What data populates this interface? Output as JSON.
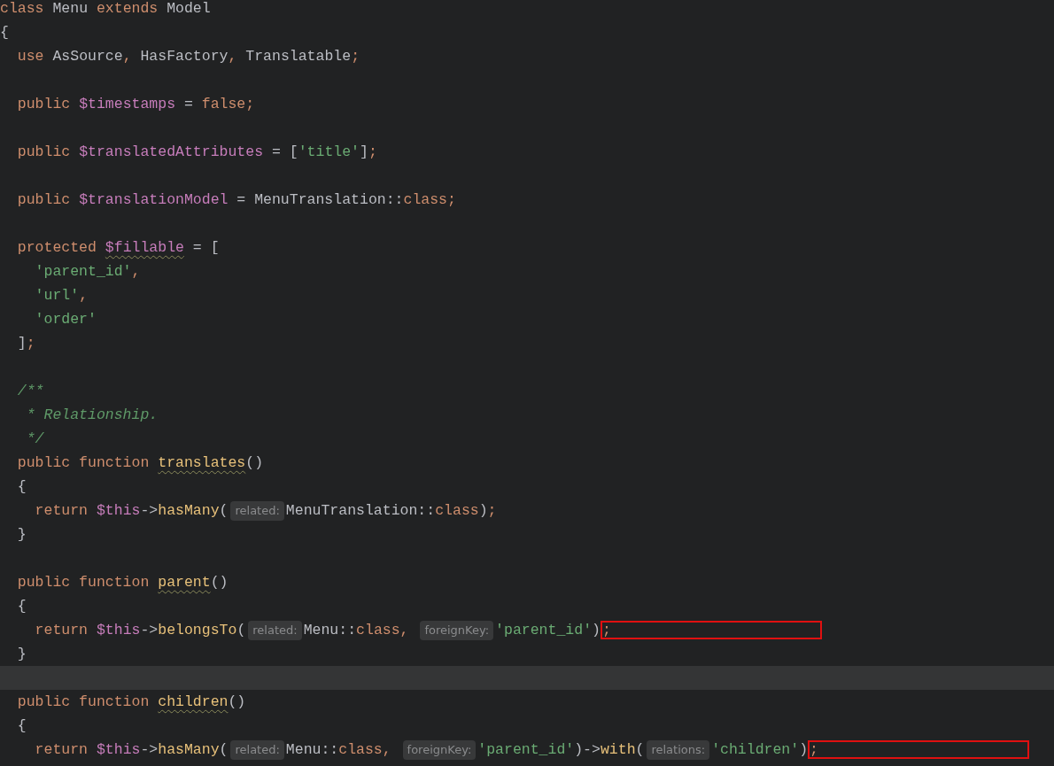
{
  "lines": [
    {
      "kind": "text",
      "segments": [
        {
          "kind": "code",
          "tokens": [
            {
              "text": "class ",
              "kind": "keyword"
            },
            {
              "text": "Menu ",
              "kind": "plain"
            },
            {
              "text": "extends ",
              "kind": "keyword"
            },
            {
              "text": "Model",
              "kind": "plain"
            }
          ]
        }
      ]
    },
    {
      "kind": "text",
      "segments": [
        {
          "kind": "code",
          "tokens": [
            {
              "text": "{",
              "kind": "plain"
            }
          ]
        }
      ]
    },
    {
      "kind": "text",
      "segments": [
        {
          "kind": "code",
          "tokens": [
            {
              "text": "  use ",
              "kind": "keyword"
            },
            {
              "text": "AsSource",
              "kind": "plain"
            },
            {
              "text": ", ",
              "kind": "punct"
            },
            {
              "text": "HasFactory",
              "kind": "plain"
            },
            {
              "text": ", ",
              "kind": "punct"
            },
            {
              "text": "Translatable",
              "kind": "plain"
            },
            {
              "text": ";",
              "kind": "punct"
            }
          ]
        }
      ]
    },
    {
      "kind": "text"
    },
    {
      "kind": "text",
      "segments": [
        {
          "kind": "code",
          "tokens": [
            {
              "text": "  public ",
              "kind": "keyword"
            },
            {
              "text": "$timestamps",
              "kind": "variable"
            },
            {
              "text": " = ",
              "kind": "plain"
            },
            {
              "text": "false",
              "kind": "keyword"
            },
            {
              "text": ";",
              "kind": "punct"
            }
          ]
        }
      ]
    },
    {
      "kind": "text"
    },
    {
      "kind": "text",
      "segments": [
        {
          "kind": "code",
          "tokens": [
            {
              "text": "  public ",
              "kind": "keyword"
            },
            {
              "text": "$translatedAttributes",
              "kind": "variable"
            },
            {
              "text": " = [",
              "kind": "plain"
            },
            {
              "text": "'title'",
              "kind": "string"
            },
            {
              "text": "]",
              "kind": "plain"
            },
            {
              "text": ";",
              "kind": "punct"
            }
          ]
        }
      ]
    },
    {
      "kind": "text"
    },
    {
      "kind": "text",
      "segments": [
        {
          "kind": "code",
          "tokens": [
            {
              "text": "  public ",
              "kind": "keyword"
            },
            {
              "text": "$translationModel",
              "kind": "variable"
            },
            {
              "text": " = MenuTranslation::",
              "kind": "plain"
            },
            {
              "text": "class",
              "kind": "keyword"
            },
            {
              "text": ";",
              "kind": "punct"
            }
          ]
        }
      ]
    },
    {
      "kind": "text"
    },
    {
      "kind": "text",
      "segments": [
        {
          "kind": "code",
          "tokens": [
            {
              "text": "  protected ",
              "kind": "keyword"
            },
            {
              "text": "$fillable",
              "kind": "variable-warned"
            },
            {
              "text": " = [",
              "kind": "plain"
            }
          ]
        }
      ]
    },
    {
      "kind": "text",
      "segments": [
        {
          "kind": "code",
          "tokens": [
            {
              "text": "    'parent_id'",
              "kind": "string"
            },
            {
              "text": ",",
              "kind": "punct"
            }
          ]
        }
      ]
    },
    {
      "kind": "text",
      "segments": [
        {
          "kind": "code",
          "tokens": [
            {
              "text": "    'url'",
              "kind": "string"
            },
            {
              "text": ",",
              "kind": "punct"
            }
          ]
        }
      ]
    },
    {
      "kind": "text",
      "segments": [
        {
          "kind": "code",
          "tokens": [
            {
              "text": "    'order'",
              "kind": "string"
            }
          ]
        }
      ]
    },
    {
      "kind": "text",
      "segments": [
        {
          "kind": "code",
          "tokens": [
            {
              "text": "  ]",
              "kind": "plain"
            },
            {
              "text": ";",
              "kind": "punct"
            }
          ]
        }
      ]
    },
    {
      "kind": "text"
    },
    {
      "kind": "text",
      "segments": [
        {
          "kind": "code",
          "tokens": [
            {
              "text": "  /**",
              "kind": "comment"
            }
          ]
        }
      ]
    },
    {
      "kind": "text",
      "segments": [
        {
          "kind": "code",
          "tokens": [
            {
              "text": "   * Relationship.",
              "kind": "comment"
            }
          ]
        }
      ]
    },
    {
      "kind": "text",
      "segments": [
        {
          "kind": "code",
          "tokens": [
            {
              "text": "   */",
              "kind": "comment"
            }
          ]
        }
      ]
    },
    {
      "kind": "text",
      "segments": [
        {
          "kind": "code",
          "tokens": [
            {
              "text": "  public function ",
              "kind": "keyword"
            },
            {
              "text": "translates",
              "kind": "function-warned"
            },
            {
              "text": "()",
              "kind": "plain"
            }
          ]
        }
      ]
    },
    {
      "kind": "text",
      "segments": [
        {
          "kind": "code",
          "tokens": [
            {
              "text": "  {",
              "kind": "plain"
            }
          ]
        }
      ]
    },
    {
      "kind": "text",
      "segments": [
        {
          "kind": "code",
          "tokens": [
            {
              "text": "    return ",
              "kind": "keyword"
            },
            {
              "text": "$this",
              "kind": "variable"
            },
            {
              "text": "->",
              "kind": "plain"
            },
            {
              "text": "hasMany",
              "kind": "function"
            },
            {
              "text": "(",
              "kind": "plain"
            }
          ]
        },
        {
          "kind": "hint",
          "text": "related:"
        },
        {
          "kind": "code",
          "tokens": [
            {
              "text": "MenuTranslation::",
              "kind": "plain"
            },
            {
              "text": "class",
              "kind": "keyword"
            },
            {
              "text": ")",
              "kind": "plain"
            },
            {
              "text": ";",
              "kind": "punct"
            }
          ]
        }
      ]
    },
    {
      "kind": "text",
      "segments": [
        {
          "kind": "code",
          "tokens": [
            {
              "text": "  }",
              "kind": "plain"
            }
          ]
        }
      ]
    },
    {
      "kind": "text"
    },
    {
      "kind": "text",
      "segments": [
        {
          "kind": "code",
          "tokens": [
            {
              "text": "  public function ",
              "kind": "keyword"
            },
            {
              "text": "parent",
              "kind": "function-warned"
            },
            {
              "text": "()",
              "kind": "plain"
            }
          ]
        }
      ]
    },
    {
      "kind": "text",
      "segments": [
        {
          "kind": "code",
          "tokens": [
            {
              "text": "  {",
              "kind": "plain"
            }
          ]
        }
      ]
    },
    {
      "kind": "text",
      "segments": [
        {
          "kind": "code",
          "tokens": [
            {
              "text": "    return ",
              "kind": "keyword"
            },
            {
              "text": "$this",
              "kind": "variable"
            },
            {
              "text": "->",
              "kind": "plain"
            },
            {
              "text": "belongsTo",
              "kind": "function"
            },
            {
              "text": "(",
              "kind": "plain"
            }
          ]
        },
        {
          "kind": "hint",
          "text": "related:"
        },
        {
          "kind": "code",
          "tokens": [
            {
              "text": "Menu::",
              "kind": "plain"
            },
            {
              "text": "class",
              "kind": "keyword"
            },
            {
              "text": ", ",
              "kind": "punct"
            }
          ]
        },
        {
          "kind": "hint",
          "text": "foreignKey:"
        },
        {
          "kind": "code",
          "tokens": [
            {
              "text": "'parent_id'",
              "kind": "string"
            },
            {
              "text": ")",
              "kind": "plain"
            }
          ]
        },
        {
          "kind": "boxed",
          "tokens": [
            {
              "text": ";",
              "kind": "punct"
            }
          ]
        }
      ]
    },
    {
      "kind": "text",
      "segments": [
        {
          "kind": "code",
          "tokens": [
            {
              "text": "  }",
              "kind": "plain"
            }
          ]
        }
      ]
    },
    {
      "kind": "caret-line"
    },
    {
      "kind": "text",
      "segments": [
        {
          "kind": "code",
          "tokens": [
            {
              "text": "  public function ",
              "kind": "keyword"
            },
            {
              "text": "children",
              "kind": "function-warned"
            },
            {
              "text": "()",
              "kind": "plain"
            }
          ]
        }
      ]
    },
    {
      "kind": "text",
      "segments": [
        {
          "kind": "code",
          "tokens": [
            {
              "text": "  {",
              "kind": "plain"
            }
          ]
        }
      ]
    },
    {
      "kind": "text",
      "segments": [
        {
          "kind": "code",
          "tokens": [
            {
              "text": "    return ",
              "kind": "keyword"
            },
            {
              "text": "$this",
              "kind": "variable"
            },
            {
              "text": "->",
              "kind": "plain"
            },
            {
              "text": "hasMany",
              "kind": "function"
            },
            {
              "text": "(",
              "kind": "plain"
            }
          ]
        },
        {
          "kind": "hint",
          "text": "related:"
        },
        {
          "kind": "code",
          "tokens": [
            {
              "text": "Menu::",
              "kind": "plain"
            },
            {
              "text": "class",
              "kind": "keyword"
            },
            {
              "text": ", ",
              "kind": "punct"
            }
          ]
        },
        {
          "kind": "hint",
          "text": "foreignKey:"
        },
        {
          "kind": "code",
          "tokens": [
            {
              "text": "'parent_id'",
              "kind": "string"
            },
            {
              "text": ")->",
              "kind": "plain"
            },
            {
              "text": "with",
              "kind": "function"
            },
            {
              "text": "(",
              "kind": "plain"
            }
          ]
        },
        {
          "kind": "hint",
          "text": "relations:"
        },
        {
          "kind": "code",
          "tokens": [
            {
              "text": "'children'",
              "kind": "string"
            },
            {
              "text": ")",
              "kind": "plain"
            }
          ]
        },
        {
          "kind": "boxed",
          "tokens": [
            {
              "text": ";",
              "kind": "punct"
            }
          ]
        }
      ]
    }
  ]
}
